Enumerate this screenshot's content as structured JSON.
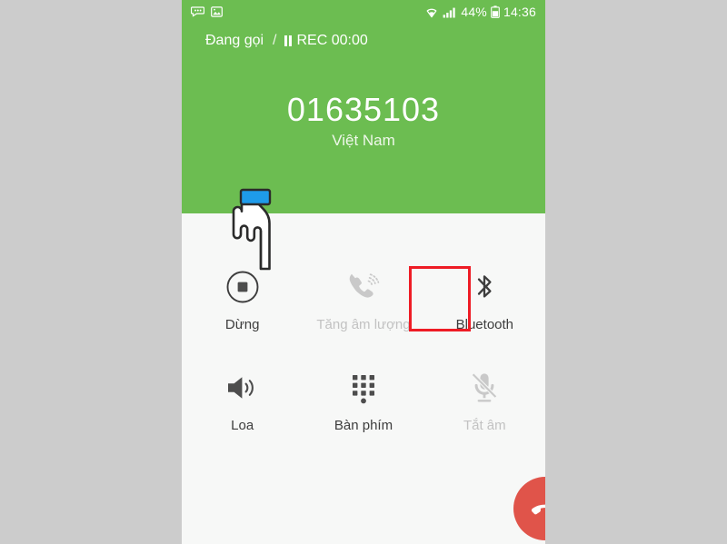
{
  "device": {
    "screen_background": "#f7f8f7",
    "page_background": "#cccccc"
  },
  "status_bar": {
    "left_icons": [
      {
        "name": "sms-message-icon",
        "glyph": "message"
      },
      {
        "name": "screenshot-image-icon",
        "glyph": "image"
      }
    ],
    "wifi_icon": "wifi-icon",
    "signal_icon": "cellular-signal-icon",
    "battery_percent": "44%",
    "battery_icon": "battery-icon",
    "clock": "14:36"
  },
  "call_header": {
    "background_color": "#6cbd51",
    "state_label": "Đang gọi",
    "divider": "/",
    "pause_icon": "pause-icon",
    "recording_label": "REC 00:00",
    "phone_number": "01635103",
    "country": "Việt Nam"
  },
  "actions": {
    "row_one": [
      {
        "key": "stop-recording",
        "label": "Dừng",
        "icon": "stop-record-icon",
        "disabled": false,
        "highlighted": true
      },
      {
        "key": "increase-volume",
        "label": "Tăng âm lượng",
        "icon": "volume-up-call-icon",
        "disabled": true,
        "highlighted": false
      },
      {
        "key": "bluetooth",
        "label": "Bluetooth",
        "icon": "bluetooth-icon",
        "disabled": false,
        "highlighted": false
      }
    ],
    "row_two": [
      {
        "key": "speaker",
        "label": "Loa",
        "icon": "speaker-icon",
        "disabled": false,
        "highlighted": false
      },
      {
        "key": "keypad",
        "label": "Bàn phím",
        "icon": "dialpad-icon",
        "disabled": false,
        "highlighted": false
      },
      {
        "key": "mute",
        "label": "Tắt âm",
        "icon": "microphone-muted-icon",
        "disabled": true,
        "highlighted": false
      }
    ]
  },
  "end_call": {
    "icon": "end-call-handset-icon",
    "color": "#e0544a"
  },
  "annotation": {
    "highlight_color": "#ee1c25",
    "cursor_icon": "pointing-hand-cursor",
    "cursor_sleeve_color": "#1e9bea"
  }
}
